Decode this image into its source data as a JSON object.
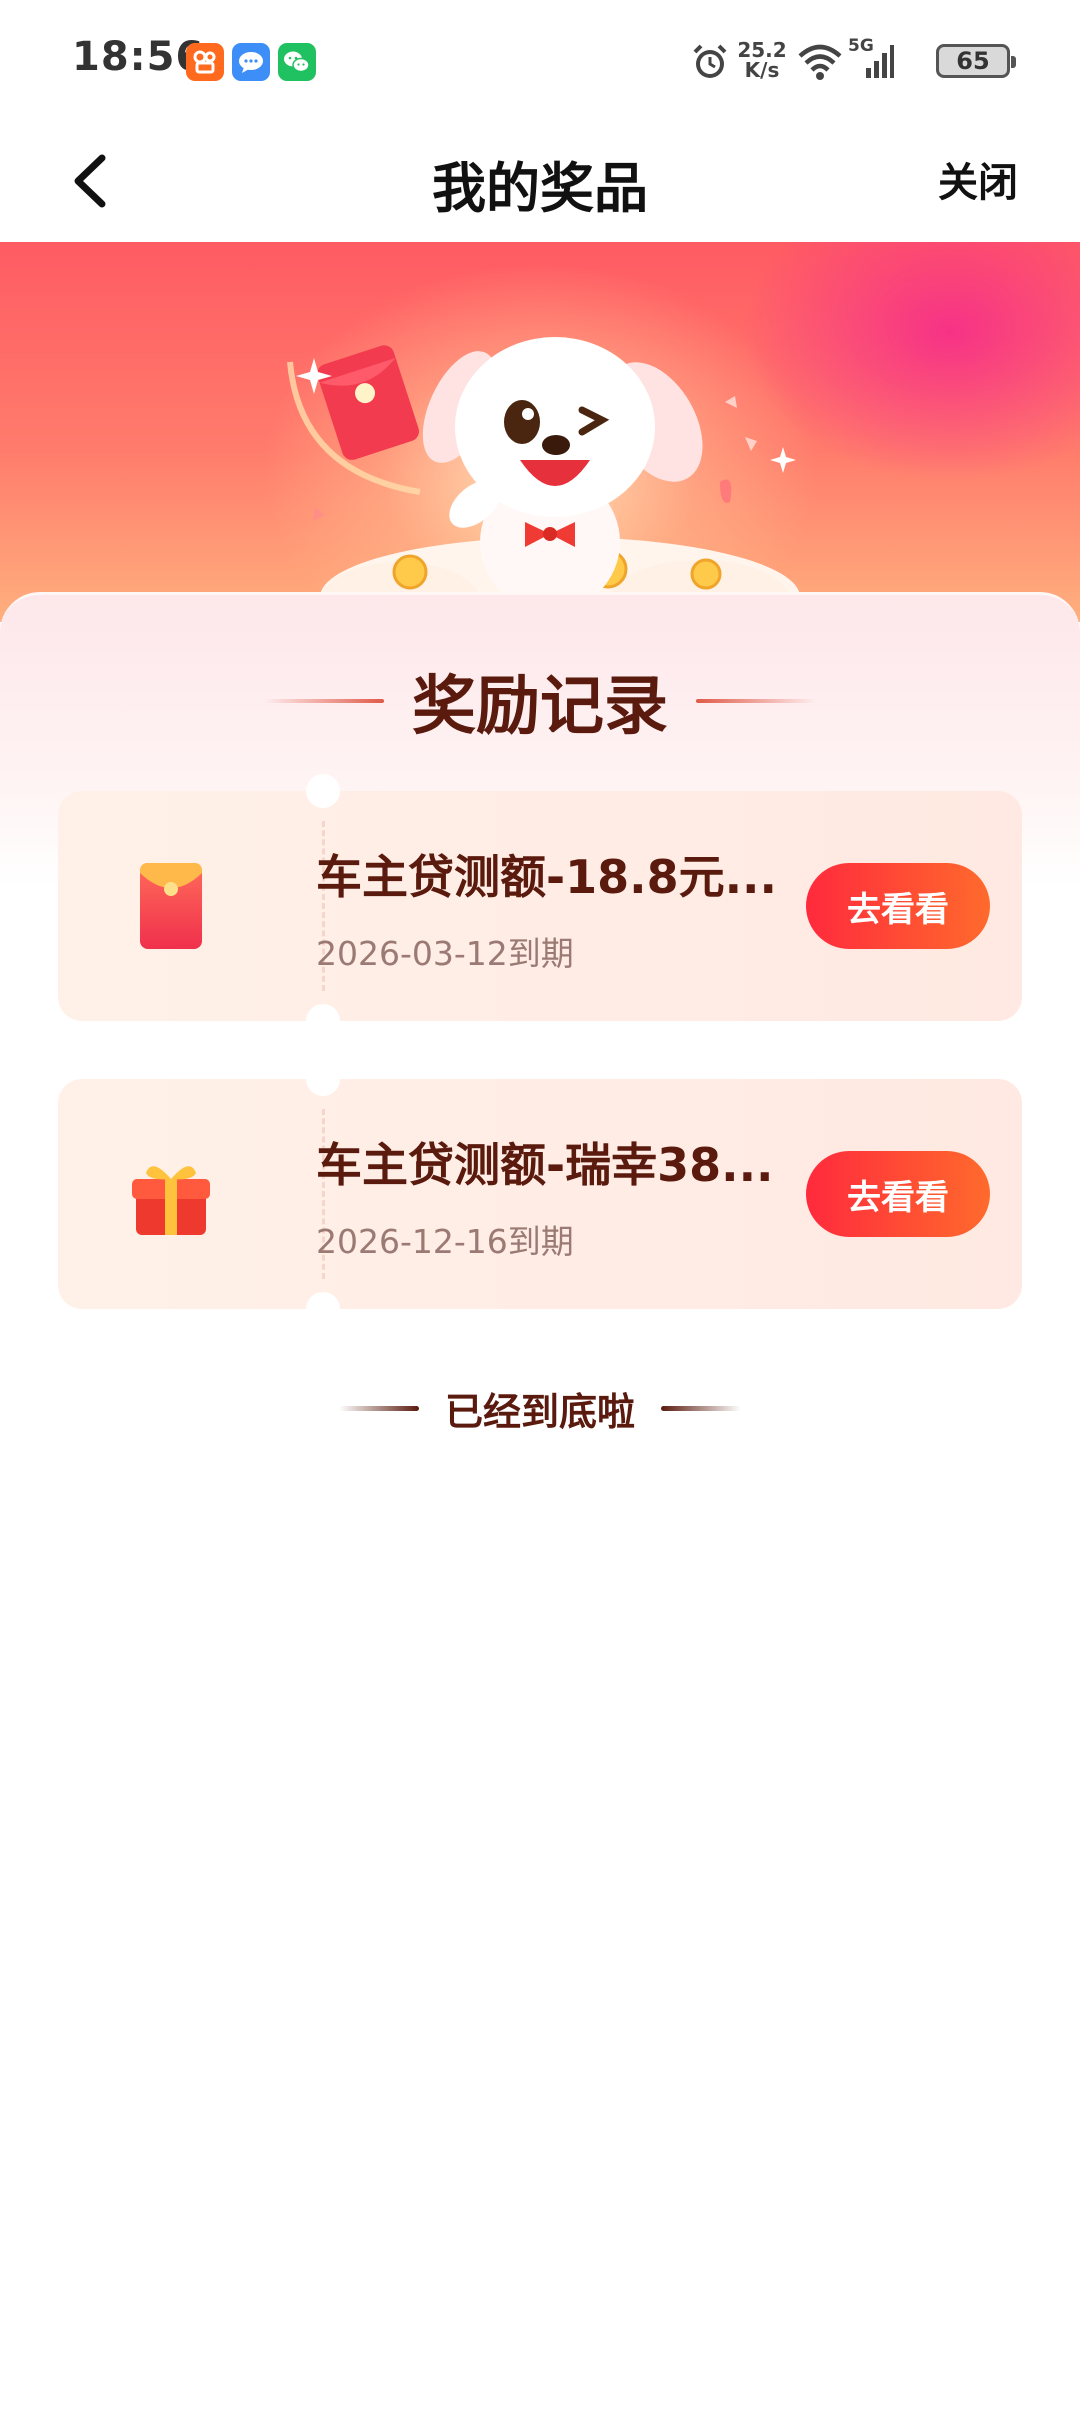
{
  "status_bar": {
    "time": "18:56",
    "network_speed_value": "25.2",
    "network_speed_unit": "K/s",
    "network_type": "5G",
    "battery": "65",
    "icons": [
      "kuaishou-app-icon",
      "messages-app-icon",
      "wechat-app-icon",
      "alarm-icon",
      "wifi-icon",
      "signal-icon",
      "battery-icon"
    ]
  },
  "header": {
    "title": "我的奖品",
    "close_label": "关闭"
  },
  "section": {
    "title": "奖励记录"
  },
  "prizes": [
    {
      "name": "车主贷测额-18.8元...",
      "expiry": "2026-03-12到期",
      "action_label": "去看看",
      "icon": "red-envelope-icon"
    },
    {
      "name": "车主贷测额-瑞幸38...",
      "expiry": "2026-12-16到期",
      "action_label": "去看看",
      "icon": "gift-box-icon"
    }
  ],
  "footer": {
    "end_text": "已经到底啦"
  },
  "colors": {
    "accent_gradient_start": "#ff2a3d",
    "accent_gradient_end": "#ff6a2c",
    "title_brown": "#5a1a0e",
    "banner_red": "#ff5b63"
  }
}
